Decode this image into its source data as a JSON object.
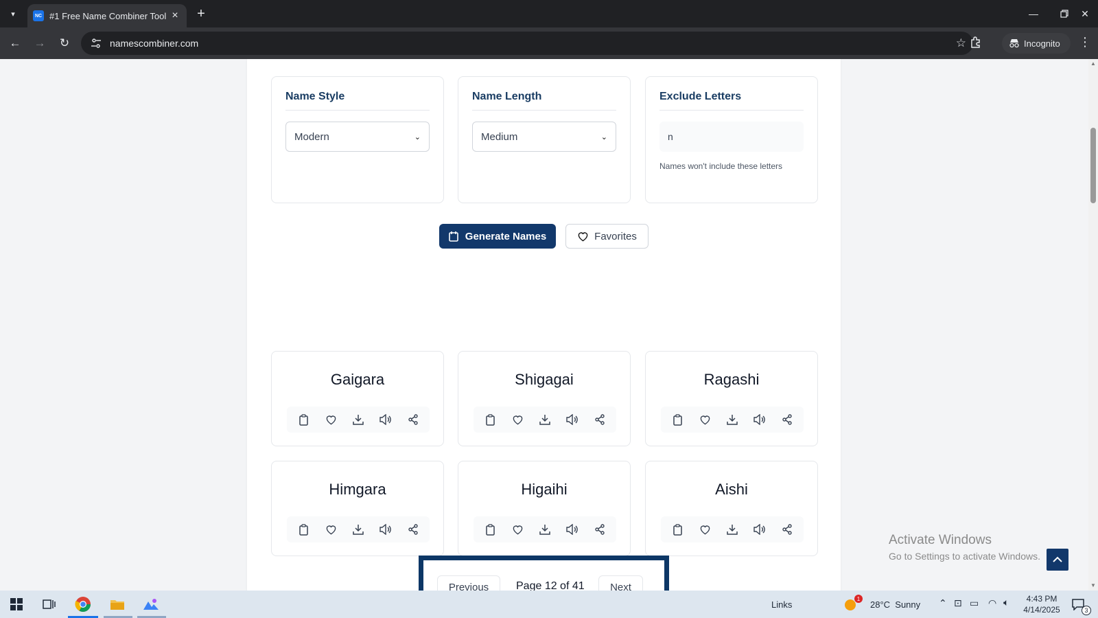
{
  "browser": {
    "tab_title": "#1 Free Name Combiner Tool",
    "favicon_text": "NC",
    "url": "namescombiner.com",
    "incognito_label": "Incognito"
  },
  "options": {
    "style": {
      "title": "Name Style",
      "value": "Modern"
    },
    "length": {
      "title": "Name Length",
      "value": "Medium"
    },
    "exclude": {
      "title": "Exclude Letters",
      "value": "n",
      "hint": "Names won't include these letters"
    }
  },
  "actions": {
    "generate_label": "Generate Names",
    "favorites_label": "Favorites"
  },
  "names": [
    "Gaigara",
    "Shigagai",
    "Ragashi",
    "Himgara",
    "Higaihi",
    "Aishi"
  ],
  "card_actions": [
    "copy-icon",
    "heart-icon",
    "download-icon",
    "speaker-icon",
    "share-icon"
  ],
  "pagination": {
    "previous_label": "Previous",
    "page_label": "Page 12 of 41",
    "next_label": "Next"
  },
  "watermark": {
    "line1": "Activate Windows",
    "line2": "Go to Settings to activate Windows."
  },
  "taskbar": {
    "links_label": "Links",
    "weather": "28°C  Sunny",
    "weather_badge": "1",
    "time": "4:43 PM",
    "date": "4/14/2025",
    "notification_count": "3"
  },
  "colors": {
    "primary": "#12386b",
    "highlight_border": "#0d3766"
  }
}
